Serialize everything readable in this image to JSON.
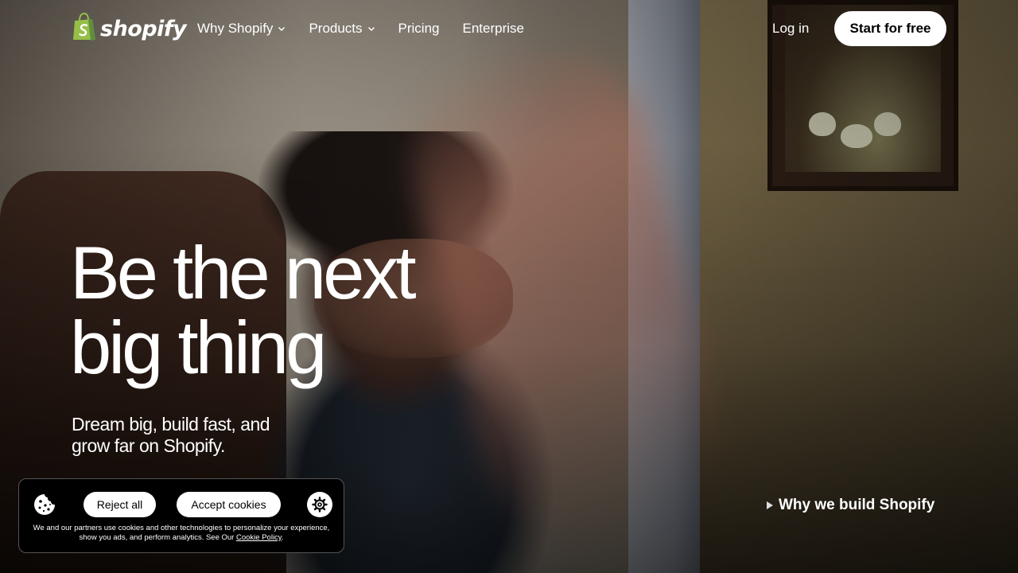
{
  "brand": {
    "name": "shopify",
    "accent": "#95BF47"
  },
  "nav": {
    "items": [
      {
        "label": "Why Shopify",
        "has_dropdown": true
      },
      {
        "label": "Products",
        "has_dropdown": true
      },
      {
        "label": "Pricing",
        "has_dropdown": false
      },
      {
        "label": "Enterprise",
        "has_dropdown": false
      }
    ],
    "login_label": "Log in",
    "cta_label": "Start for free"
  },
  "hero": {
    "title_line1": "Be the next",
    "title_line2": "big thing",
    "subtitle_line1": "Dream big, build fast, and",
    "subtitle_line2": "grow far on Shopify."
  },
  "video_link": {
    "label": "Why we build Shopify",
    "icon": "play-icon"
  },
  "cookie_banner": {
    "reject_label": "Reject all",
    "accept_label": "Accept cookies",
    "message": "We and our partners use cookies and other technologies to personalize your experience, show you ads, and perform analytics. See Our",
    "policy_link": "Cookie Policy",
    "policy_suffix": ".",
    "icons": [
      "cookie-icon",
      "gear-icon"
    ]
  }
}
